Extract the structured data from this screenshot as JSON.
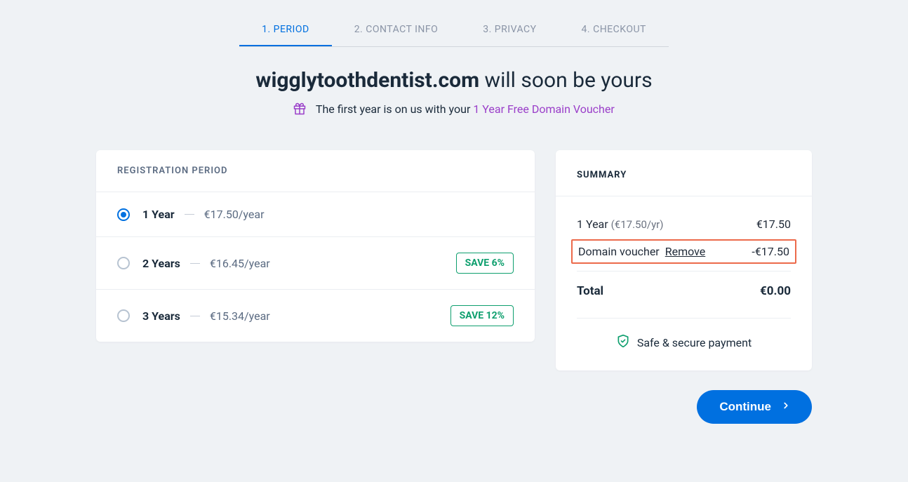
{
  "tabs": {
    "tab1": "1.  PERIOD",
    "tab2": "2.  CONTACT INFO",
    "tab3": "3.  PRIVACY",
    "tab4": "4.  CHECKOUT"
  },
  "heading": {
    "domain": "wigglytoothdentist.com",
    "suffix": " will soon be yours"
  },
  "subheading": {
    "text": "The first year is on us with your ",
    "link": "1 Year Free Domain Voucher"
  },
  "registration": {
    "header": "REGISTRATION PERIOD",
    "options": [
      {
        "label": "1 Year",
        "price": "€17.50/year",
        "save": ""
      },
      {
        "label": "2 Years",
        "price": "€16.45/year",
        "save": "SAVE 6%"
      },
      {
        "label": "3 Years",
        "price": "€15.34/year",
        "save": "SAVE 12%"
      }
    ]
  },
  "summary": {
    "header": "SUMMARY",
    "line1_label": "1 Year",
    "line1_rate": "(€17.50/yr)",
    "line1_amount": "€17.50",
    "voucher_label": "Domain voucher",
    "voucher_remove": "Remove",
    "voucher_amount": "-€17.50",
    "total_label": "Total",
    "total_amount": "€0.00",
    "secure_text": "Safe & secure payment"
  },
  "continue_label": "Continue"
}
